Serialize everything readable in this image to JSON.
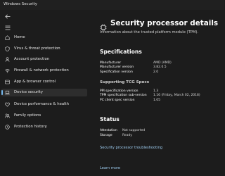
{
  "window": {
    "title": "Windows Security"
  },
  "sidebar": {
    "back_icon": "back-arrow-icon",
    "menu_icon": "hamburger-menu-icon",
    "items": [
      {
        "label": "Home",
        "icon": "home-icon",
        "selected": false
      },
      {
        "label": "Virus & threat protection",
        "icon": "shield-icon",
        "selected": false
      },
      {
        "label": "Account protection",
        "icon": "person-icon",
        "selected": false
      },
      {
        "label": "Firewall & network protection",
        "icon": "wifi-icon",
        "selected": false
      },
      {
        "label": "App & browser control",
        "icon": "app-window-icon",
        "selected": false
      },
      {
        "label": "Device security",
        "icon": "laptop-icon",
        "selected": true
      },
      {
        "label": "Device performance & health",
        "icon": "heart-icon",
        "selected": false
      },
      {
        "label": "Family options",
        "icon": "family-icon",
        "selected": false
      },
      {
        "label": "Protection history",
        "icon": "history-icon",
        "selected": false
      }
    ]
  },
  "main": {
    "title": "Security processor details",
    "title_icon": "chip-icon",
    "subtitle": "Information about the trusted platform module (TPM).",
    "specifications": {
      "heading": "Specifications",
      "rows": [
        {
          "label": "Manufacturer",
          "value": "AMD (AMD)"
        },
        {
          "label": "Manufacturer version",
          "value": "3.82.0.5"
        },
        {
          "label": "Specification version",
          "value": "2.0"
        }
      ]
    },
    "tcg": {
      "heading": "Supporting TCG Specs",
      "rows": [
        {
          "label": "PPI specification version",
          "value": "1.3"
        },
        {
          "label": "TPM specification sub-version",
          "value": "1.16 (Friday, March 02, 2018)"
        },
        {
          "label": "PC client spec version",
          "value": "1.05"
        }
      ]
    },
    "status": {
      "heading": "Status",
      "rows": [
        {
          "label": "Attestation",
          "value": "Not supported"
        },
        {
          "label": "Storage",
          "value": "Ready"
        }
      ]
    },
    "troubleshooting_link": "Security processor troubleshooting",
    "learn_more_link": "Learn more"
  },
  "colors": {
    "background": "#1c1c1c",
    "selected_item": "#2d2d2d",
    "accent": "#76b9ed",
    "link": "#9fcff3"
  }
}
